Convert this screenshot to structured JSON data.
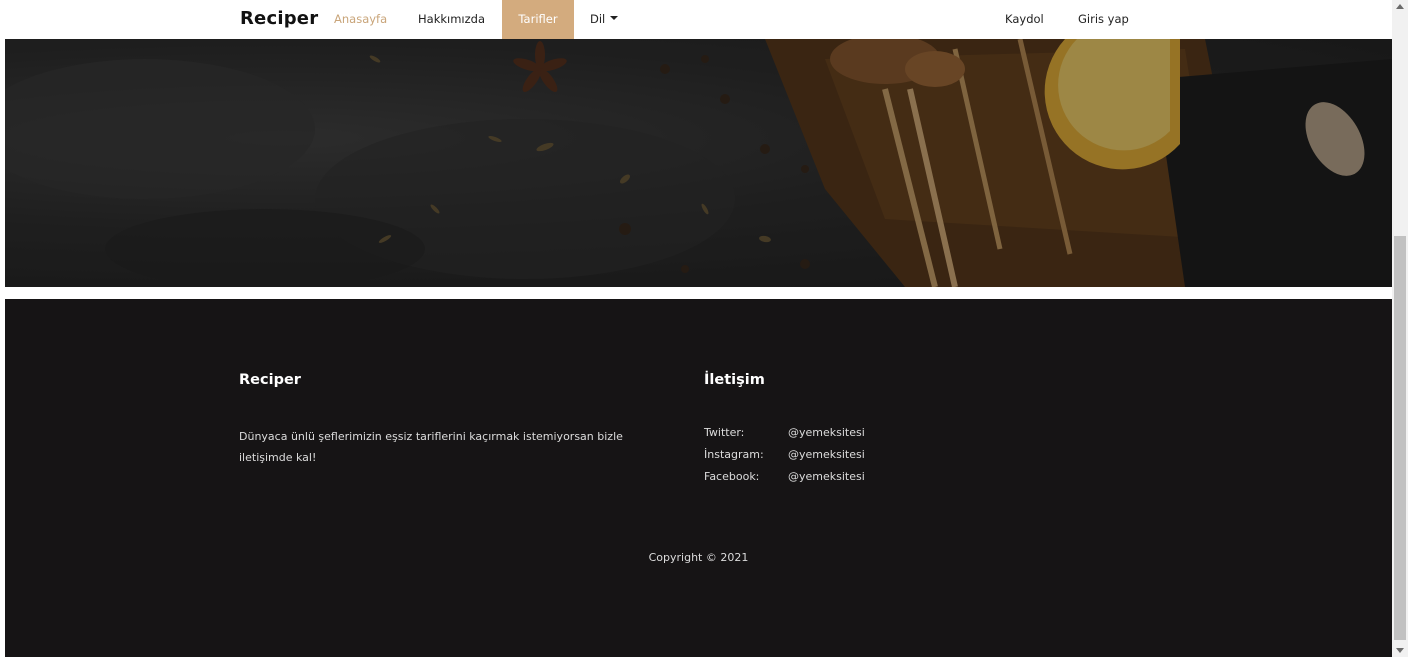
{
  "navbar": {
    "brand": "Reciper",
    "links": {
      "home": "Anasayfa",
      "about": "Hakkımızda",
      "recipes": "Tarifler",
      "language": "Dil",
      "signup": "Kaydol",
      "login": "Giris yap"
    },
    "active_link": "Tarifler"
  },
  "footer": {
    "brand_title": "Reciper",
    "description": "Dünyaca ünlü şeflerimizin eşsiz tariflerini kaçırmak istemiyorsan bizle iletişimde kal!",
    "contact_title": "İletişim",
    "contacts": [
      {
        "label": "Twitter:",
        "handle": "@yemeksitesi"
      },
      {
        "label": "İnstagram:",
        "handle": "@yemeksitesi"
      },
      {
        "label": "Facebook:",
        "handle": "@yemeksitesi"
      }
    ],
    "copyright": "Copyright © 2021"
  },
  "colors": {
    "accent": "#d3ab7e",
    "home_link": "#c9a57a",
    "footer_bg": "#161415"
  }
}
